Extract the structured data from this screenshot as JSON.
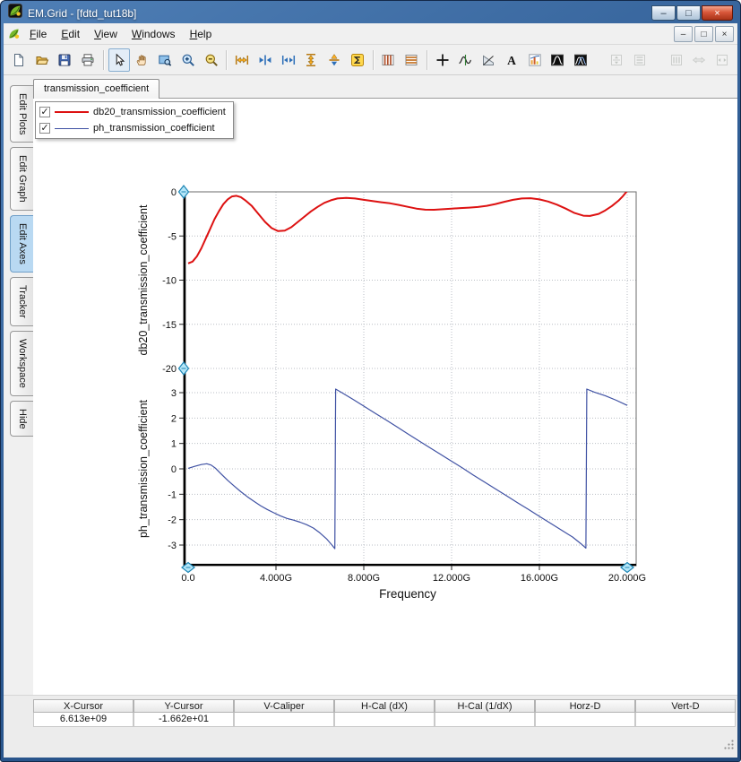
{
  "window": {
    "title": "EM.Grid - [fdtd_tut18b]",
    "caption_buttons": [
      {
        "name": "minimize-button",
        "glyph": "–"
      },
      {
        "name": "maximize-button",
        "glyph": "□"
      },
      {
        "name": "close-button",
        "glyph": "×"
      }
    ],
    "mdi_buttons": [
      {
        "name": "mdi-minimize-button",
        "glyph": "–"
      },
      {
        "name": "mdi-restore-button",
        "glyph": "□"
      },
      {
        "name": "mdi-close-button",
        "glyph": "×"
      }
    ]
  },
  "menu": {
    "items": [
      {
        "label": "File"
      },
      {
        "label": "Edit"
      },
      {
        "label": "View"
      },
      {
        "label": "Windows"
      },
      {
        "label": "Help"
      }
    ]
  },
  "toolbar": {
    "groups": [
      {
        "buttons": [
          {
            "name": "new-document",
            "kind": "page"
          },
          {
            "name": "open-file",
            "kind": "folder"
          },
          {
            "name": "save-file",
            "kind": "floppy"
          },
          {
            "name": "print",
            "kind": "printer"
          }
        ]
      },
      {
        "buttons": [
          {
            "name": "select-cursor",
            "kind": "cursor",
            "active": true
          },
          {
            "name": "pan",
            "kind": "hand"
          },
          {
            "name": "zoom-window",
            "kind": "zoomrect"
          },
          {
            "name": "zoom-in",
            "kind": "zoomin"
          },
          {
            "name": "zoom-out",
            "kind": "zoomout"
          }
        ]
      },
      {
        "buttons": [
          {
            "name": "expand-x",
            "kind": "hexpand"
          },
          {
            "name": "scale-x",
            "kind": "harrows"
          },
          {
            "name": "compress-x",
            "kind": "hcompress"
          },
          {
            "name": "expand-y",
            "kind": "vexpand"
          },
          {
            "name": "scale-y",
            "kind": "varrows"
          },
          {
            "name": "auto-scale",
            "kind": "sigma"
          }
        ]
      },
      {
        "buttons": [
          {
            "name": "vertical-grid",
            "kind": "columns"
          },
          {
            "name": "horizontal-grid",
            "kind": "rows"
          }
        ]
      },
      {
        "buttons": [
          {
            "name": "crosshair-cursor",
            "kind": "crosshair"
          },
          {
            "name": "tracker-cursor",
            "kind": "tracker"
          },
          {
            "name": "slope-measure",
            "kind": "slope"
          },
          {
            "name": "text-annotation",
            "kind": "textA"
          },
          {
            "name": "insert-chart",
            "kind": "minichart"
          },
          {
            "name": "fft",
            "kind": "wave1"
          },
          {
            "name": "windowed-fft",
            "kind": "wave2"
          }
        ]
      },
      {
        "gap_before": true,
        "buttons": [
          {
            "name": "fit-vertical",
            "kind": "vframe",
            "disabled": true
          },
          {
            "name": "vertical-range",
            "kind": "vframe2",
            "disabled": true
          }
        ]
      },
      {
        "gap_before": true,
        "buttons": [
          {
            "name": "horizontal-range",
            "kind": "hframe",
            "disabled": true
          },
          {
            "name": "expand-horizontal",
            "kind": "hexpand2",
            "disabled": true
          },
          {
            "name": "fit-horizontal",
            "kind": "hframe2",
            "disabled": true
          }
        ]
      }
    ]
  },
  "sidebar": {
    "tabs": [
      {
        "label": "Edit Plots"
      },
      {
        "label": "Edit Graph"
      },
      {
        "label": "Edit Axes",
        "active": true
      },
      {
        "label": "Tracker"
      },
      {
        "label": "Workspace"
      },
      {
        "label": "Hide"
      }
    ]
  },
  "document_tab": {
    "label": "transmission_coefficient"
  },
  "legend": {
    "entries": [
      {
        "label": "db20_transmission_coefficient",
        "color": "#dd1111",
        "thickness": 2,
        "checked": true
      },
      {
        "label": "ph_transmission_coefficient",
        "color": "#3f51a3",
        "thickness": 1,
        "checked": true
      }
    ]
  },
  "chart_data": {
    "type": "line",
    "xlabel": "Frequency",
    "x_unit": "GHz",
    "x_range": [
      0,
      20
    ],
    "x_ticks": [
      0,
      4,
      8,
      12,
      16,
      20
    ],
    "x_tick_labels": [
      "0.0",
      "4.000G",
      "8.000G",
      "12.000G",
      "16.000G",
      "20.000G"
    ],
    "grid": true,
    "legend_position": "top-left",
    "subplots": [
      {
        "name": "db20_transmission_coefficient",
        "ylabel": "db20_transmission_coefficient",
        "y_range": [
          0,
          -20
        ],
        "y_ticks": [
          0,
          -5,
          -10,
          -15,
          -20
        ],
        "y_tick_labels": [
          "0",
          "-5",
          "-10",
          "-15",
          "-20"
        ],
        "series": {
          "color": "#dd1111",
          "width": 2,
          "points": [
            [
              0,
              -8.1
            ],
            [
              0.2,
              -7.9
            ],
            [
              0.4,
              -7.3
            ],
            [
              0.6,
              -6.4
            ],
            [
              0.8,
              -5.3
            ],
            [
              1.0,
              -4.2
            ],
            [
              1.2,
              -3.1
            ],
            [
              1.4,
              -2.2
            ],
            [
              1.6,
              -1.4
            ],
            [
              1.8,
              -0.85
            ],
            [
              2.0,
              -0.52
            ],
            [
              2.2,
              -0.45
            ],
            [
              2.4,
              -0.6
            ],
            [
              2.6,
              -0.95
            ],
            [
              2.9,
              -1.6
            ],
            [
              3.2,
              -2.5
            ],
            [
              3.5,
              -3.4
            ],
            [
              3.8,
              -4.1
            ],
            [
              4.1,
              -4.45
            ],
            [
              4.4,
              -4.4
            ],
            [
              4.7,
              -4.0
            ],
            [
              5.0,
              -3.4
            ],
            [
              5.3,
              -2.8
            ],
            [
              5.6,
              -2.2
            ],
            [
              5.9,
              -1.7
            ],
            [
              6.2,
              -1.25
            ],
            [
              6.5,
              -0.95
            ],
            [
              6.8,
              -0.75
            ],
            [
              7.2,
              -0.68
            ],
            [
              7.6,
              -0.75
            ],
            [
              8.0,
              -0.9
            ],
            [
              8.4,
              -1.05
            ],
            [
              8.8,
              -1.18
            ],
            [
              9.2,
              -1.3
            ],
            [
              9.6,
              -1.48
            ],
            [
              10.0,
              -1.7
            ],
            [
              10.4,
              -1.9
            ],
            [
              10.8,
              -2.02
            ],
            [
              11.2,
              -2.03
            ],
            [
              11.6,
              -1.97
            ],
            [
              12.0,
              -1.9
            ],
            [
              12.4,
              -1.84
            ],
            [
              12.8,
              -1.79
            ],
            [
              13.2,
              -1.72
            ],
            [
              13.6,
              -1.58
            ],
            [
              14.0,
              -1.38
            ],
            [
              14.4,
              -1.13
            ],
            [
              14.8,
              -0.9
            ],
            [
              15.2,
              -0.75
            ],
            [
              15.6,
              -0.72
            ],
            [
              16.0,
              -0.85
            ],
            [
              16.4,
              -1.1
            ],
            [
              16.8,
              -1.45
            ],
            [
              17.2,
              -1.9
            ],
            [
              17.6,
              -2.4
            ],
            [
              18.0,
              -2.7
            ],
            [
              18.3,
              -2.73
            ],
            [
              18.7,
              -2.5
            ],
            [
              19.0,
              -2.1
            ],
            [
              19.3,
              -1.6
            ],
            [
              19.6,
              -1.0
            ],
            [
              19.8,
              -0.5
            ],
            [
              20.0,
              0.1
            ]
          ]
        }
      },
      {
        "name": "ph_transmission_coefficient",
        "ylabel": "ph_transmission_coefficient",
        "y_range": [
          3,
          -3
        ],
        "y_ticks": [
          3,
          2,
          1,
          0,
          -1,
          -2,
          -3
        ],
        "y_tick_labels": [
          "3",
          "2",
          "1",
          "0",
          "-1",
          "-2",
          "-3"
        ],
        "series": {
          "color": "#3f51a3",
          "width": 1.2,
          "points": [
            [
              0,
              0.02
            ],
            [
              0.3,
              0.1
            ],
            [
              0.6,
              0.17
            ],
            [
              0.85,
              0.2
            ],
            [
              1.05,
              0.15
            ],
            [
              1.25,
              0.02
            ],
            [
              1.5,
              -0.2
            ],
            [
              1.8,
              -0.45
            ],
            [
              2.1,
              -0.68
            ],
            [
              2.4,
              -0.9
            ],
            [
              2.7,
              -1.1
            ],
            [
              3.0,
              -1.28
            ],
            [
              3.3,
              -1.45
            ],
            [
              3.6,
              -1.6
            ],
            [
              3.9,
              -1.73
            ],
            [
              4.2,
              -1.85
            ],
            [
              4.5,
              -1.95
            ],
            [
              4.8,
              -2.02
            ],
            [
              5.1,
              -2.1
            ],
            [
              5.4,
              -2.2
            ],
            [
              5.7,
              -2.33
            ],
            [
              6.0,
              -2.52
            ],
            [
              6.3,
              -2.75
            ],
            [
              6.55,
              -3.0
            ],
            [
              6.68,
              -3.14
            ],
            [
              6.72,
              3.14
            ],
            [
              7.0,
              3.0
            ],
            [
              7.5,
              2.74
            ],
            [
              8.0,
              2.47
            ],
            [
              8.5,
              2.2
            ],
            [
              9.0,
              1.93
            ],
            [
              9.5,
              1.66
            ],
            [
              10.0,
              1.38
            ],
            [
              10.5,
              1.11
            ],
            [
              11.0,
              0.84
            ],
            [
              11.5,
              0.57
            ],
            [
              12.0,
              0.3
            ],
            [
              12.5,
              0.03
            ],
            [
              13.0,
              -0.25
            ],
            [
              13.5,
              -0.52
            ],
            [
              14.0,
              -0.79
            ],
            [
              14.5,
              -1.06
            ],
            [
              15.0,
              -1.33
            ],
            [
              15.5,
              -1.6
            ],
            [
              16.0,
              -1.87
            ],
            [
              16.5,
              -2.14
            ],
            [
              17.0,
              -2.41
            ],
            [
              17.5,
              -2.68
            ],
            [
              17.9,
              -2.95
            ],
            [
              18.12,
              -3.12
            ],
            [
              18.16,
              3.14
            ],
            [
              18.5,
              3.02
            ],
            [
              19.0,
              2.88
            ],
            [
              19.5,
              2.7
            ],
            [
              20.0,
              2.5
            ]
          ]
        }
      }
    ]
  },
  "status_bar": {
    "columns": [
      "X-Cursor",
      "Y-Cursor",
      "V-Caliper",
      "H-Cal (dX)",
      "H-Cal (1/dX)",
      "Horz-D",
      "Vert-D"
    ],
    "values": [
      "6.613e+09",
      "-1.662e+01",
      "",
      "",
      "",
      "",
      ""
    ]
  }
}
